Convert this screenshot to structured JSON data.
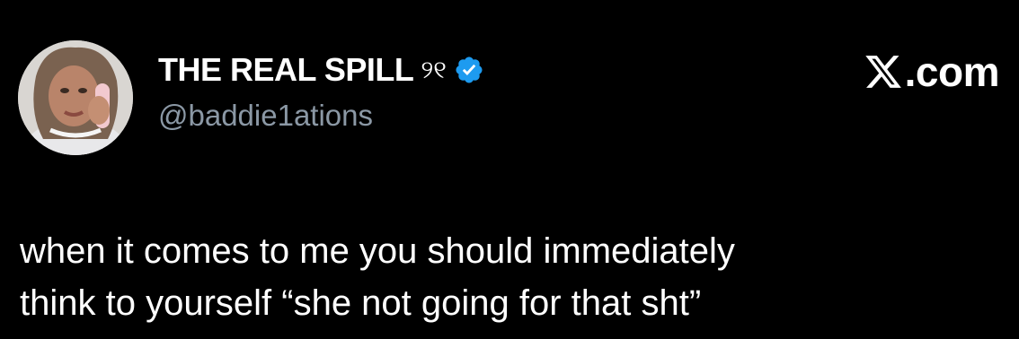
{
  "author": {
    "display_name": "THE REAL SPILL",
    "name_emoji": "୨୧",
    "handle": "@baddie1ations",
    "verified": true,
    "avatar": "avatar-photo"
  },
  "brand": {
    "icon": "x-logo-icon",
    "text": ".com"
  },
  "tweet": {
    "lines": [
      "when it comes to me you should immediately",
      "think to yourself “she not going for that sht”"
    ]
  },
  "colors": {
    "background": "#000000",
    "primary_text": "#ffffff",
    "secondary_text": "#8b98a5",
    "verified_blue": "#1d9bf0"
  }
}
